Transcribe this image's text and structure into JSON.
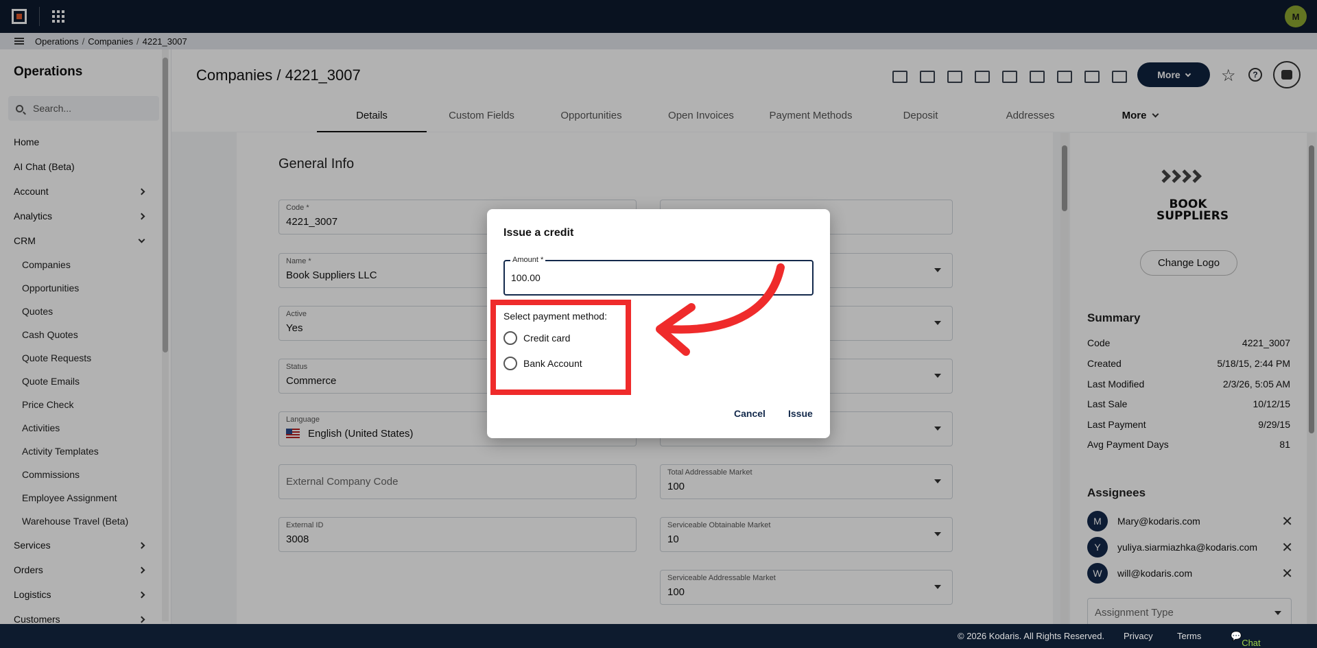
{
  "breadcrumb": [
    "Operations",
    "Companies",
    "4221_3007"
  ],
  "user_initial": "M",
  "sidebar": {
    "title": "Operations",
    "search_placeholder": "Search...",
    "items": [
      {
        "label": "Home",
        "chevron": "none"
      },
      {
        "label": "AI Chat (Beta)",
        "chevron": "none"
      },
      {
        "label": "Account",
        "chevron": "right"
      },
      {
        "label": "Analytics",
        "chevron": "right"
      },
      {
        "label": "CRM",
        "chevron": "down"
      }
    ],
    "crm_items": [
      "Companies",
      "Opportunities",
      "Quotes",
      "Cash Quotes",
      "Quote Requests",
      "Quote Emails",
      "Price Check",
      "Activities",
      "Activity Templates",
      "Commissions",
      "Employee Assignment",
      "Warehouse Travel (Beta)"
    ],
    "after_items": [
      "Services",
      "Orders",
      "Logistics",
      "Customers"
    ]
  },
  "header": {
    "title": "Companies / 4221_3007",
    "more_label": "More",
    "toolbar_icons": [
      "cloud-upload-icon",
      "mail-icon",
      "credit-card-check-icon",
      "gift-icon",
      "building-plus-icon",
      "screen-plus-icon",
      "person-add-icon",
      "document-plus-icon",
      "paperclip-icon"
    ]
  },
  "tabs": [
    "Details",
    "Custom Fields",
    "Opportunities",
    "Open Invoices",
    "Payment Methods",
    "Deposit",
    "Addresses",
    "More"
  ],
  "general": {
    "title": "General Info",
    "code_label": "Code *",
    "code_value": "4221_3007",
    "name_label": "Name *",
    "name_value": "Book Suppliers LLC",
    "active_label": "Active",
    "active_value": "Yes",
    "status_label": "Status",
    "status_value": "Commerce",
    "language_label": "Language",
    "language_value": "English (United States)",
    "ext_code_placeholder": "External Company Code",
    "ext_id_label": "External ID",
    "ext_id_value": "3008",
    "tam_label": "Total Addressable Market",
    "tam_value": "100",
    "som_label": "Serviceable Obtainable Market",
    "som_value": "10",
    "sam_label": "Serviceable Addressable Market",
    "sam_value": "100"
  },
  "right_panel": {
    "logo_text": "BOOK SUPPLIERS",
    "change_logo": "Change Logo",
    "summary_title": "Summary",
    "summary": [
      {
        "k": "Code",
        "v": "4221_3007"
      },
      {
        "k": "Created",
        "v": "5/18/15, 2:44 PM"
      },
      {
        "k": "Last Modified",
        "v": "2/3/26, 5:05 AM"
      },
      {
        "k": "Last Sale",
        "v": "10/12/15"
      },
      {
        "k": "Last Payment",
        "v": "9/29/15"
      },
      {
        "k": "Avg Payment Days",
        "v": "81"
      }
    ],
    "assignees_title": "Assignees",
    "assignees": [
      {
        "initial": "M",
        "email": "Mary@kodaris.com"
      },
      {
        "initial": "Y",
        "email": "yuliya.siarmiazhka@kodaris.com"
      },
      {
        "initial": "W",
        "email": "will@kodaris.com"
      }
    ],
    "assignment_type_placeholder": "Assignment Type"
  },
  "footer": {
    "copyright": "© 2026 Kodaris. All Rights Reserved.",
    "privacy": "Privacy",
    "terms": "Terms",
    "chat": "Chat with us"
  },
  "modal": {
    "title": "Issue a credit",
    "amount_label": "Amount *",
    "amount_value": "100.00",
    "method_prompt": "Select payment method:",
    "options": [
      "Credit card",
      "Bank Account"
    ],
    "cancel": "Cancel",
    "issue": "Issue"
  },
  "colors": {
    "navy": "#0d1b2e",
    "accent": "#13294b",
    "highlight": "#ef2b2b",
    "chat": "#9fd24a"
  }
}
